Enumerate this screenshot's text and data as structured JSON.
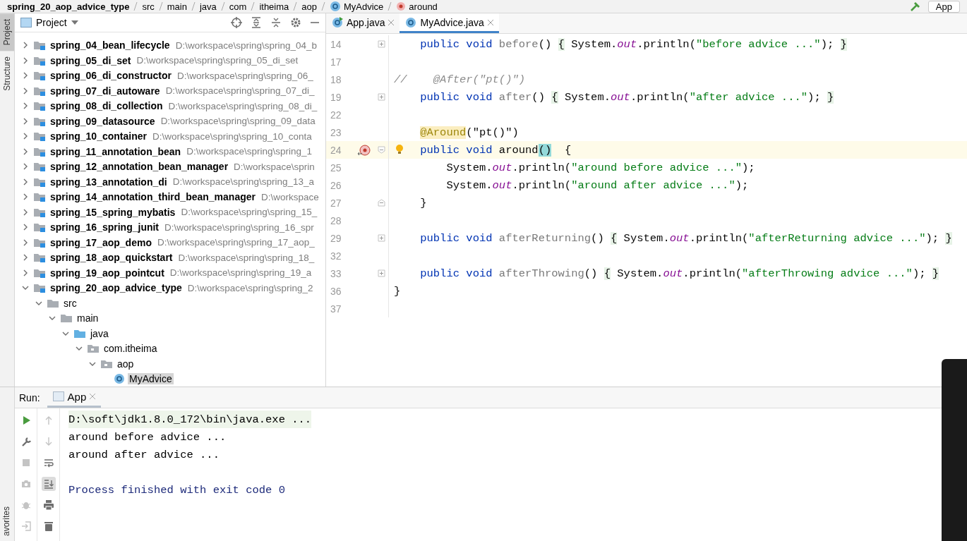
{
  "breadcrumb": {
    "items": [
      {
        "label": "spring_20_aop_advice_type",
        "kind": "module"
      },
      {
        "label": "src",
        "kind": "folder"
      },
      {
        "label": "main",
        "kind": "folder"
      },
      {
        "label": "java",
        "kind": "folder"
      },
      {
        "label": "com",
        "kind": "folder"
      },
      {
        "label": "itheima",
        "kind": "folder"
      },
      {
        "label": "aop",
        "kind": "folder"
      },
      {
        "label": "MyAdvice",
        "kind": "class"
      },
      {
        "label": "around",
        "kind": "method"
      }
    ],
    "run_config": "App"
  },
  "tool_strip": [
    {
      "label": "Project",
      "selected": true
    },
    {
      "label": "Structure",
      "selected": false
    }
  ],
  "tool_strip_bottom": "avorites",
  "project": {
    "title": "Project",
    "tree": [
      {
        "name": "spring_04_bean_lifecycle",
        "path": "D:\\workspace\\spring\\spring_04_b",
        "kind": "module",
        "expanded": false,
        "selected": false
      },
      {
        "name": "spring_05_di_set",
        "path": "D:\\workspace\\spring\\spring_05_di_set",
        "kind": "module",
        "expanded": false,
        "selected": false
      },
      {
        "name": "spring_06_di_constructor",
        "path": "D:\\workspace\\spring\\spring_06_",
        "kind": "module",
        "expanded": false,
        "selected": false
      },
      {
        "name": "spring_07_di_autoware",
        "path": "D:\\workspace\\spring\\spring_07_di_",
        "kind": "module",
        "expanded": false,
        "selected": false
      },
      {
        "name": "spring_08_di_collection",
        "path": "D:\\workspace\\spring\\spring_08_di_",
        "kind": "module",
        "expanded": false,
        "selected": false
      },
      {
        "name": "spring_09_datasource",
        "path": "D:\\workspace\\spring\\spring_09_data",
        "kind": "module",
        "expanded": false,
        "selected": false
      },
      {
        "name": "spring_10_container",
        "path": "D:\\workspace\\spring\\spring_10_conta",
        "kind": "module",
        "expanded": false,
        "selected": false
      },
      {
        "name": "spring_11_annotation_bean",
        "path": "D:\\workspace\\spring\\spring_1",
        "kind": "module",
        "expanded": false,
        "selected": false
      },
      {
        "name": "spring_12_annotation_bean_manager",
        "path": "D:\\workspace\\sprin",
        "kind": "module",
        "expanded": false,
        "selected": false
      },
      {
        "name": "spring_13_annotation_di",
        "path": "D:\\workspace\\spring\\spring_13_a",
        "kind": "module",
        "expanded": false,
        "selected": false
      },
      {
        "name": "spring_14_annotation_third_bean_manager",
        "path": "D:\\workspace",
        "kind": "module",
        "expanded": false,
        "selected": false
      },
      {
        "name": "spring_15_spring_mybatis",
        "path": "D:\\workspace\\spring\\spring_15_",
        "kind": "module",
        "expanded": false,
        "selected": false
      },
      {
        "name": "spring_16_spring_junit",
        "path": "D:\\workspace\\spring\\spring_16_spr",
        "kind": "module",
        "expanded": false,
        "selected": false
      },
      {
        "name": "spring_17_aop_demo",
        "path": "D:\\workspace\\spring\\spring_17_aop_",
        "kind": "module",
        "expanded": false,
        "selected": false
      },
      {
        "name": "spring_18_aop_quickstart",
        "path": "D:\\workspace\\spring\\spring_18_",
        "kind": "module",
        "expanded": false,
        "selected": false
      },
      {
        "name": "spring_19_aop_pointcut",
        "path": "D:\\workspace\\spring\\spring_19_a",
        "kind": "module",
        "expanded": false,
        "selected": false
      },
      {
        "name": "spring_20_aop_advice_type",
        "path": "D:\\workspace\\spring\\spring_2",
        "kind": "module",
        "expanded": true,
        "selected": false,
        "children": [
          {
            "name": "src",
            "kind": "folder",
            "expanded": true,
            "selected": false,
            "children": [
              {
                "name": "main",
                "kind": "folder",
                "expanded": true,
                "selected": false,
                "children": [
                  {
                    "name": "java",
                    "kind": "source_folder",
                    "expanded": true,
                    "selected": false,
                    "children": [
                      {
                        "name": "com.itheima",
                        "kind": "package",
                        "expanded": true,
                        "selected": false,
                        "children": [
                          {
                            "name": "aop",
                            "kind": "package",
                            "expanded": true,
                            "selected": false,
                            "children": [
                              {
                                "name": "MyAdvice",
                                "kind": "class",
                                "selected": true
                              }
                            ]
                          }
                        ]
                      }
                    ]
                  }
                ]
              }
            ]
          }
        ]
      }
    ]
  },
  "editor": {
    "tabs": [
      {
        "label": "App.java",
        "kind": "runnable_class",
        "selected": false
      },
      {
        "label": "MyAdvice.java",
        "kind": "class",
        "selected": true
      }
    ],
    "lines": [
      {
        "number": "14",
        "fold": {
          "kind": "collapsed"
        },
        "tokens": [
          {
            "text": "    public void ",
            "kind": "keyword"
          },
          {
            "text": "before",
            "kind": "unused"
          },
          {
            "text": "() ",
            "kind": "plain"
          },
          {
            "text": "{",
            "kind": "fold_brace"
          },
          {
            "text": " System.",
            "kind": "plain"
          },
          {
            "text": "out",
            "kind": "static"
          },
          {
            "text": ".println(",
            "kind": "plain"
          },
          {
            "text": "\"before advice ...\"",
            "kind": "string"
          },
          {
            "text": "); ",
            "kind": "plain"
          },
          {
            "text": "}",
            "kind": "fold_brace"
          }
        ]
      },
      {
        "number": "17"
      },
      {
        "number": "18",
        "tokens": [
          {
            "text": "//    @After(\"pt()\")",
            "kind": "comment"
          }
        ]
      },
      {
        "number": "19",
        "fold": {
          "kind": "collapsed"
        },
        "tokens": [
          {
            "text": "    public void ",
            "kind": "keyword"
          },
          {
            "text": "after",
            "kind": "unused"
          },
          {
            "text": "() ",
            "kind": "plain"
          },
          {
            "text": "{",
            "kind": "fold_brace"
          },
          {
            "text": " System.",
            "kind": "plain"
          },
          {
            "text": "out",
            "kind": "static"
          },
          {
            "text": ".println(",
            "kind": "plain"
          },
          {
            "text": "\"after advice ...\"",
            "kind": "string"
          },
          {
            "text": "); ",
            "kind": "plain"
          },
          {
            "text": "}",
            "kind": "fold_brace"
          }
        ]
      },
      {
        "number": "22"
      },
      {
        "number": "23",
        "tokens": [
          {
            "text": "    @Around",
            "kind": "annotation"
          },
          {
            "text": "(\"pt()\")",
            "kind": "plain"
          }
        ]
      },
      {
        "number": "24",
        "fold": {
          "kind": "open"
        },
        "current": true,
        "override": true,
        "bulb": true,
        "tokens": [
          {
            "text": "    public void ",
            "kind": "keyword"
          },
          {
            "text": "around",
            "kind": "plain"
          },
          {
            "text": "()",
            "kind": "matched"
          },
          {
            "text": "  {",
            "kind": "plain"
          }
        ]
      },
      {
        "number": "25",
        "tokens": [
          {
            "text": "        System.",
            "kind": "plain"
          },
          {
            "text": "out",
            "kind": "static"
          },
          {
            "text": ".println(",
            "kind": "plain"
          },
          {
            "text": "\"around before advice ...\"",
            "kind": "string"
          },
          {
            "text": ");",
            "kind": "plain"
          }
        ]
      },
      {
        "number": "26",
        "tokens": [
          {
            "text": "        System.",
            "kind": "plain"
          },
          {
            "text": "out",
            "kind": "static"
          },
          {
            "text": ".println(",
            "kind": "plain"
          },
          {
            "text": "\"around after advice ...\"",
            "kind": "string"
          },
          {
            "text": ");",
            "kind": "plain"
          }
        ]
      },
      {
        "number": "27",
        "fold": {
          "kind": "close"
        },
        "tokens": [
          {
            "text": "    }",
            "kind": "plain"
          }
        ]
      },
      {
        "number": "28"
      },
      {
        "number": "29",
        "fold": {
          "kind": "collapsed"
        },
        "tokens": [
          {
            "text": "    public void ",
            "kind": "keyword"
          },
          {
            "text": "afterReturning",
            "kind": "unused"
          },
          {
            "text": "() ",
            "kind": "plain"
          },
          {
            "text": "{",
            "kind": "fold_brace"
          },
          {
            "text": " System.",
            "kind": "plain"
          },
          {
            "text": "out",
            "kind": "static"
          },
          {
            "text": ".println(",
            "kind": "plain"
          },
          {
            "text": "\"afterReturning advice ...\"",
            "kind": "string"
          },
          {
            "text": "); ",
            "kind": "plain"
          },
          {
            "text": "}",
            "kind": "fold_brace"
          }
        ]
      },
      {
        "number": "32"
      },
      {
        "number": "33",
        "fold": {
          "kind": "collapsed"
        },
        "tokens": [
          {
            "text": "    public void ",
            "kind": "keyword"
          },
          {
            "text": "afterThrowing",
            "kind": "unused"
          },
          {
            "text": "() ",
            "kind": "plain"
          },
          {
            "text": "{",
            "kind": "fold_brace"
          },
          {
            "text": " System.",
            "kind": "plain"
          },
          {
            "text": "out",
            "kind": "static"
          },
          {
            "text": ".println(",
            "kind": "plain"
          },
          {
            "text": "\"afterThrowing advice ...\"",
            "kind": "string"
          },
          {
            "text": "); ",
            "kind": "plain"
          },
          {
            "text": "}",
            "kind": "fold_brace"
          }
        ]
      },
      {
        "number": "36",
        "tokens": [
          {
            "text": "}",
            "kind": "plain"
          }
        ]
      },
      {
        "number": "37"
      }
    ]
  },
  "run": {
    "label": "Run:",
    "tabs": [
      {
        "label": "App",
        "selected": true
      }
    ],
    "toolbar_1": [
      {
        "kind": "run",
        "disabled": false
      },
      {
        "kind": "wrench",
        "disabled": false
      },
      {
        "kind": "stop",
        "disabled": true
      },
      {
        "kind": "camera",
        "disabled": true
      },
      {
        "kind": "bug",
        "disabled": true
      },
      {
        "kind": "exit",
        "disabled": true
      }
    ],
    "toolbar_2": [
      {
        "kind": "up",
        "disabled": true
      },
      {
        "kind": "down",
        "disabled": true
      },
      {
        "kind": "wrap",
        "disabled": false
      },
      {
        "kind": "scroll_end",
        "disabled": false,
        "on": true
      },
      {
        "kind": "print",
        "disabled": false
      },
      {
        "kind": "trash",
        "disabled": false
      }
    ],
    "console": [
      {
        "text": "D:\\soft\\jdk1.8.0_172\\bin\\java.exe ...",
        "kind": "command"
      },
      {
        "text": "around before advice ...",
        "kind": "output"
      },
      {
        "text": "around after advice ...",
        "kind": "output"
      },
      {
        "kind": "blank"
      },
      {
        "text": "Process finished with exit code 0",
        "kind": "system"
      }
    ]
  }
}
